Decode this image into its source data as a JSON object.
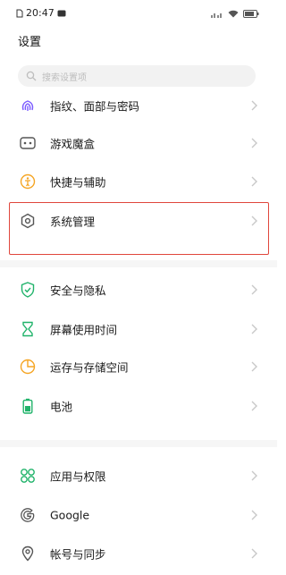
{
  "status_bar": {
    "time": "20:47"
  },
  "page": {
    "title": "设置"
  },
  "search": {
    "placeholder": "搜索设置项"
  },
  "settings": [
    {
      "label": "指纹、面部与密码",
      "icon": "fingerprint-icon",
      "accent": "#7b5cff"
    },
    {
      "label": "游戏魔盒",
      "icon": "game-box-icon",
      "accent": "#555555"
    },
    {
      "label": "快捷与辅助",
      "icon": "accessibility-icon",
      "accent": "#f5a524"
    },
    {
      "label": "系统管理",
      "icon": "gear-icon",
      "accent": "#555555",
      "highlighted": true
    },
    {
      "label": "安全与隐私",
      "icon": "shield-icon",
      "accent": "#20b36a"
    },
    {
      "label": "屏幕使用时间",
      "icon": "hourglass-icon",
      "accent": "#20b36a"
    },
    {
      "label": "运存与存储空间",
      "icon": "storage-icon",
      "accent": "#f5a524"
    },
    {
      "label": "电池",
      "icon": "battery-icon",
      "accent": "#20b36a"
    },
    {
      "label": "应用与权限",
      "icon": "apps-icon",
      "accent": "#20b36a"
    },
    {
      "label": "Google",
      "icon": "google-icon",
      "accent": "#555555"
    },
    {
      "label": "帐号与同步",
      "icon": "account-sync-icon",
      "accent": "#555555"
    }
  ],
  "colors": {
    "highlight": "#e0463c",
    "chevron": "#c8c8c8"
  }
}
